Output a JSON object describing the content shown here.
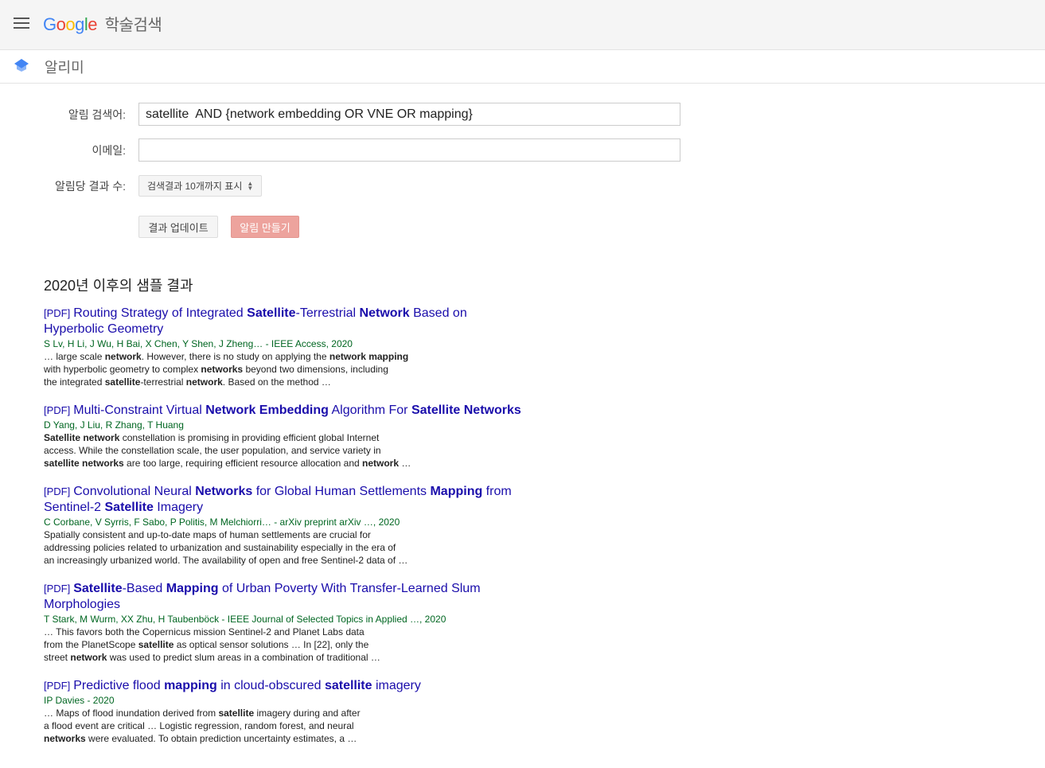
{
  "header": {
    "logo_letters": [
      "G",
      "o",
      "o",
      "g",
      "l",
      "e"
    ],
    "product": "학술검색"
  },
  "subheader": {
    "title": "알리미"
  },
  "form": {
    "query_label": "알림 검색어:",
    "query_value": "satellite  AND {network embedding OR VNE OR mapping}",
    "email_label": "이메일:",
    "email_value": "",
    "count_label": "알림당 결과 수:",
    "count_value": "검색결과 10개까지 표시",
    "update_button": "결과 업데이트",
    "create_button": "알림 만들기"
  },
  "sample_title": "2020년 이후의 샘플 결과",
  "results": [
    {
      "tag": "[PDF]",
      "title": [
        [
          "Routing Strategy of Integrated ",
          0
        ],
        [
          "Satellite",
          1
        ],
        [
          "-Terrestrial ",
          0
        ],
        [
          "Network",
          1
        ],
        [
          " Based on Hyperbolic Geometry",
          0
        ]
      ],
      "authors": "S Lv, H Li, J Wu, H Bai, X Chen, Y Shen, J Zheng… - IEEE Access, 2020",
      "snippet": [
        [
          [
            "… large scale ",
            0
          ],
          [
            "network",
            1
          ],
          [
            ". However, there is no study on applying the ",
            0
          ],
          [
            "network mapping",
            1
          ]
        ],
        [
          [
            "with hyperbolic geometry to complex ",
            0
          ],
          [
            "networks",
            1
          ],
          [
            " beyond two dimensions, including",
            0
          ]
        ],
        [
          [
            "the integrated ",
            0
          ],
          [
            "satellite",
            1
          ],
          [
            "-terrestrial ",
            0
          ],
          [
            "network",
            1
          ],
          [
            ". Based on the method …",
            0
          ]
        ]
      ]
    },
    {
      "tag": "[PDF]",
      "title": [
        [
          "Multi-Constraint Virtual ",
          0
        ],
        [
          "Network Embedding",
          1
        ],
        [
          " Algorithm For ",
          0
        ],
        [
          "Satellite Networks",
          1
        ]
      ],
      "authors": "D Yang, J Liu, R Zhang, T Huang",
      "snippet": [
        [
          [
            "Satellite network",
            1
          ],
          [
            " constellation is promising in providing efficient global Internet",
            0
          ]
        ],
        [
          [
            "access. While the constellation scale, the user population, and service variety in",
            0
          ]
        ],
        [
          [
            "satellite networks",
            1
          ],
          [
            " are too large, requiring efficient resource allocation and ",
            0
          ],
          [
            "network",
            1
          ],
          [
            "  …",
            0
          ]
        ]
      ]
    },
    {
      "tag": "[PDF]",
      "title": [
        [
          "Convolutional Neural ",
          0
        ],
        [
          "Networks",
          1
        ],
        [
          " for Global Human Settlements ",
          0
        ],
        [
          "Mapping",
          1
        ],
        [
          " from Sentinel-2 ",
          0
        ],
        [
          "Satellite",
          1
        ],
        [
          " Imagery",
          0
        ]
      ],
      "authors": "C Corbane, V Syrris, F Sabo, P Politis, M Melchiorri… - arXiv preprint arXiv …, 2020",
      "snippet": [
        [
          [
            "Spatially consistent and up-to-date maps of human settlements are crucial for",
            0
          ]
        ],
        [
          [
            "addressing policies related to urbanization and sustainability especially in the era of",
            0
          ]
        ],
        [
          [
            "an increasingly urbanized world. The availability of open and free Sentinel-2 data of …",
            0
          ]
        ]
      ]
    },
    {
      "tag": "[PDF]",
      "title": [
        [
          "Satellite",
          1
        ],
        [
          "-Based ",
          0
        ],
        [
          "Mapping",
          1
        ],
        [
          " of Urban Poverty With Transfer-Learned Slum Morphologies",
          0
        ]
      ],
      "authors": "T Stark, M Wurm, XX Zhu, H Taubenböck - IEEE Journal of Selected Topics in Applied …, 2020",
      "snippet": [
        [
          [
            "… This favors both the Copernicus mission Sentinel-2 and Planet Labs data",
            0
          ]
        ],
        [
          [
            "from the PlanetScope ",
            0
          ],
          [
            "satellite",
            1
          ],
          [
            " as optical sensor solutions … In [22], only the",
            0
          ]
        ],
        [
          [
            "street ",
            0
          ],
          [
            "network",
            1
          ],
          [
            " was used to predict slum areas in a combination of traditional …",
            0
          ]
        ]
      ]
    },
    {
      "tag": "[PDF]",
      "title": [
        [
          "Predictive flood ",
          0
        ],
        [
          "mapping",
          1
        ],
        [
          " in cloud-obscured ",
          0
        ],
        [
          "satellite",
          1
        ],
        [
          " imagery",
          0
        ]
      ],
      "authors": "IP Davies - 2020",
      "snippet": [
        [
          [
            "… Maps of flood inundation derived from ",
            0
          ],
          [
            "satellite",
            1
          ],
          [
            " imagery during and after",
            0
          ]
        ],
        [
          [
            "a flood event are critical … Logistic regression, random forest, and neural",
            0
          ]
        ],
        [
          [
            "networks",
            1
          ],
          [
            " were evaluated. To obtain prediction uncertainty estimates, a …",
            0
          ]
        ]
      ]
    }
  ]
}
